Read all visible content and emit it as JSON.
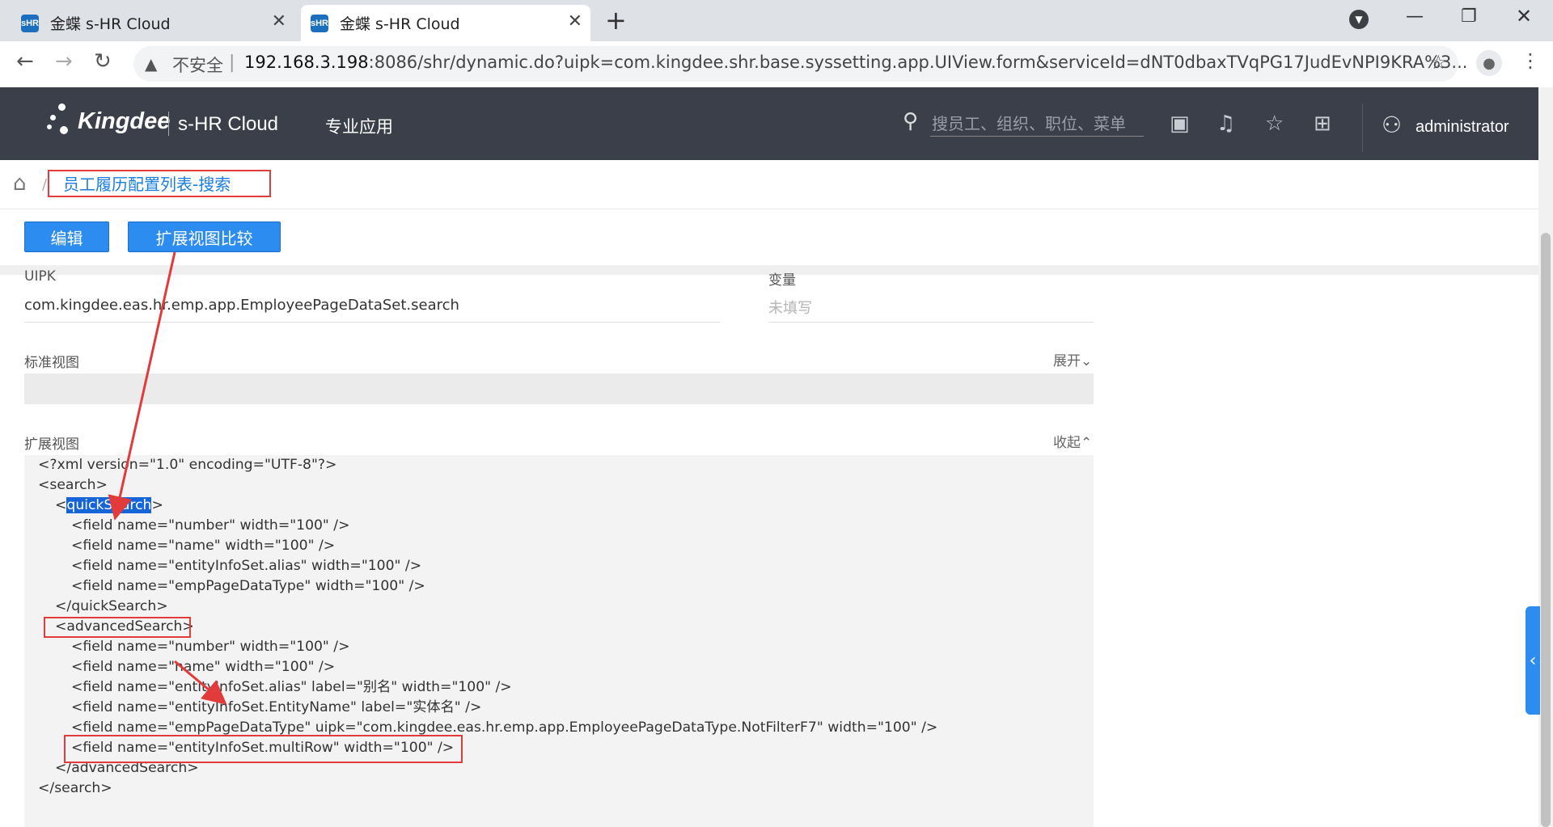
{
  "browser": {
    "tabs": [
      {
        "favicon": "sHR",
        "title": "金蝶 s-HR Cloud"
      },
      {
        "favicon": "sHR",
        "title": "金蝶 s-HR Cloud"
      }
    ],
    "new_tab_icon": "+",
    "insecure_label": "不安全",
    "url_host": "192.168.3.198",
    "url_rest": ":8086/shr/dynamic.do?uipk=com.kingdee.shr.base.syssetting.app.UIView.form&serviceId=dNT0dbaxTVqPG17JudEvNPI9KRA%3..."
  },
  "app": {
    "brand": "Kingdee",
    "product": "s-HR Cloud",
    "menu_item": "专业应用",
    "search_placeholder": "搜员工、组织、职位、菜单",
    "username": "administrator",
    "colors": {
      "header_bg": "#3b3f4a",
      "primary": "#2d8cf0",
      "annotation_red": "#e23b3b"
    }
  },
  "breadcrumb": {
    "title": "员工履历配置列表-搜索"
  },
  "actions": {
    "edit_label": "编辑",
    "compare_label": "扩展视图比较"
  },
  "form": {
    "uipk_label": "UIPK",
    "uipk_value": "com.kingdee.eas.hr.emp.app.EmployeePageDataSet.search",
    "variable_label": "变量",
    "variable_value": "未填写",
    "standard_view_label": "标准视图",
    "standard_view_toggle": "展开",
    "extended_view_label": "扩展视图",
    "extended_view_toggle": "收起"
  },
  "xml": {
    "l1": "<?xml version=\"1.0\" encoding=\"UTF-8\"?>",
    "l2": "<search>",
    "l3_open": "<",
    "l3_sel": "quickSearch",
    "l3_close": ">",
    "l4": "<field name=\"number\" width=\"100\" />",
    "l5": "<field name=\"name\" width=\"100\" />",
    "l6": "<field name=\"entityInfoSet.alias\" width=\"100\" />",
    "l7": "<field name=\"empPageDataType\" width=\"100\" />",
    "l8": "</quickSearch>",
    "l9": "<advancedSearch>",
    "l10": "<field name=\"number\" width=\"100\" />",
    "l11": "<field name=\"name\" width=\"100\" />",
    "l12": "<field name=\"entityInfoSet.alias\" label=\"别名\" width=\"100\" />",
    "l13": "<field name=\"entityInfoSet.EntityName\" label=\"实体名\" />",
    "l14": "<field name=\"empPageDataType\" uipk=\"com.kingdee.eas.hr.emp.app.EmployeePageDataType.NotFilterF7\" width=\"100\" />",
    "l15": "<field name=\"entityInfoSet.multiRow\" width=\"100\" />",
    "l16": "</advancedSearch>",
    "l17": "</search>"
  }
}
